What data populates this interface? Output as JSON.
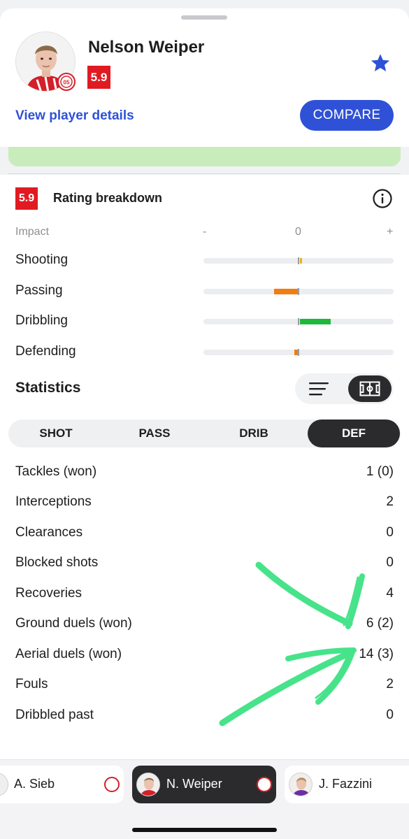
{
  "player": {
    "name": "Nelson Weiper",
    "rating": "5.9",
    "details_link": "View player details",
    "compare_label": "COMPARE"
  },
  "rating_breakdown": {
    "rating": "5.9",
    "title": "Rating breakdown",
    "impact_label": "Impact",
    "minus": "-",
    "zero": "0",
    "plus": "+",
    "categories": [
      {
        "label": "Shooting",
        "impact": 0.01,
        "color": "#e5b41f"
      },
      {
        "label": "Passing",
        "impact": -0.25,
        "color": "#ef7d12"
      },
      {
        "label": "Dribbling",
        "impact": 0.32,
        "color": "#1db83a"
      },
      {
        "label": "Defending",
        "impact": -0.04,
        "color": "#ef7d12"
      }
    ]
  },
  "statistics": {
    "title": "Statistics",
    "tabs": [
      "SHOT",
      "PASS",
      "DRIB",
      "DEF"
    ],
    "active_tab": "DEF",
    "rows": [
      {
        "label": "Tackles (won)",
        "value": "1 (0)"
      },
      {
        "label": "Interceptions",
        "value": "2"
      },
      {
        "label": "Clearances",
        "value": "0"
      },
      {
        "label": "Blocked shots",
        "value": "0"
      },
      {
        "label": "Recoveries",
        "value": "4"
      },
      {
        "label": "Ground duels (won)",
        "value": "6 (2)"
      },
      {
        "label": "Aerial duels (won)",
        "value": "14 (3)"
      },
      {
        "label": "Fouls",
        "value": "2"
      },
      {
        "label": "Dribbled past",
        "value": "0"
      }
    ]
  },
  "player_switcher": [
    {
      "name": "A. Sieb",
      "active": false
    },
    {
      "name": "N. Weiper",
      "active": true
    },
    {
      "name": "J. Fazzini",
      "active": false
    }
  ],
  "colors": {
    "accent": "#2f51d7",
    "rating_bad": "#e11a22",
    "annotation": "#34e07e"
  }
}
